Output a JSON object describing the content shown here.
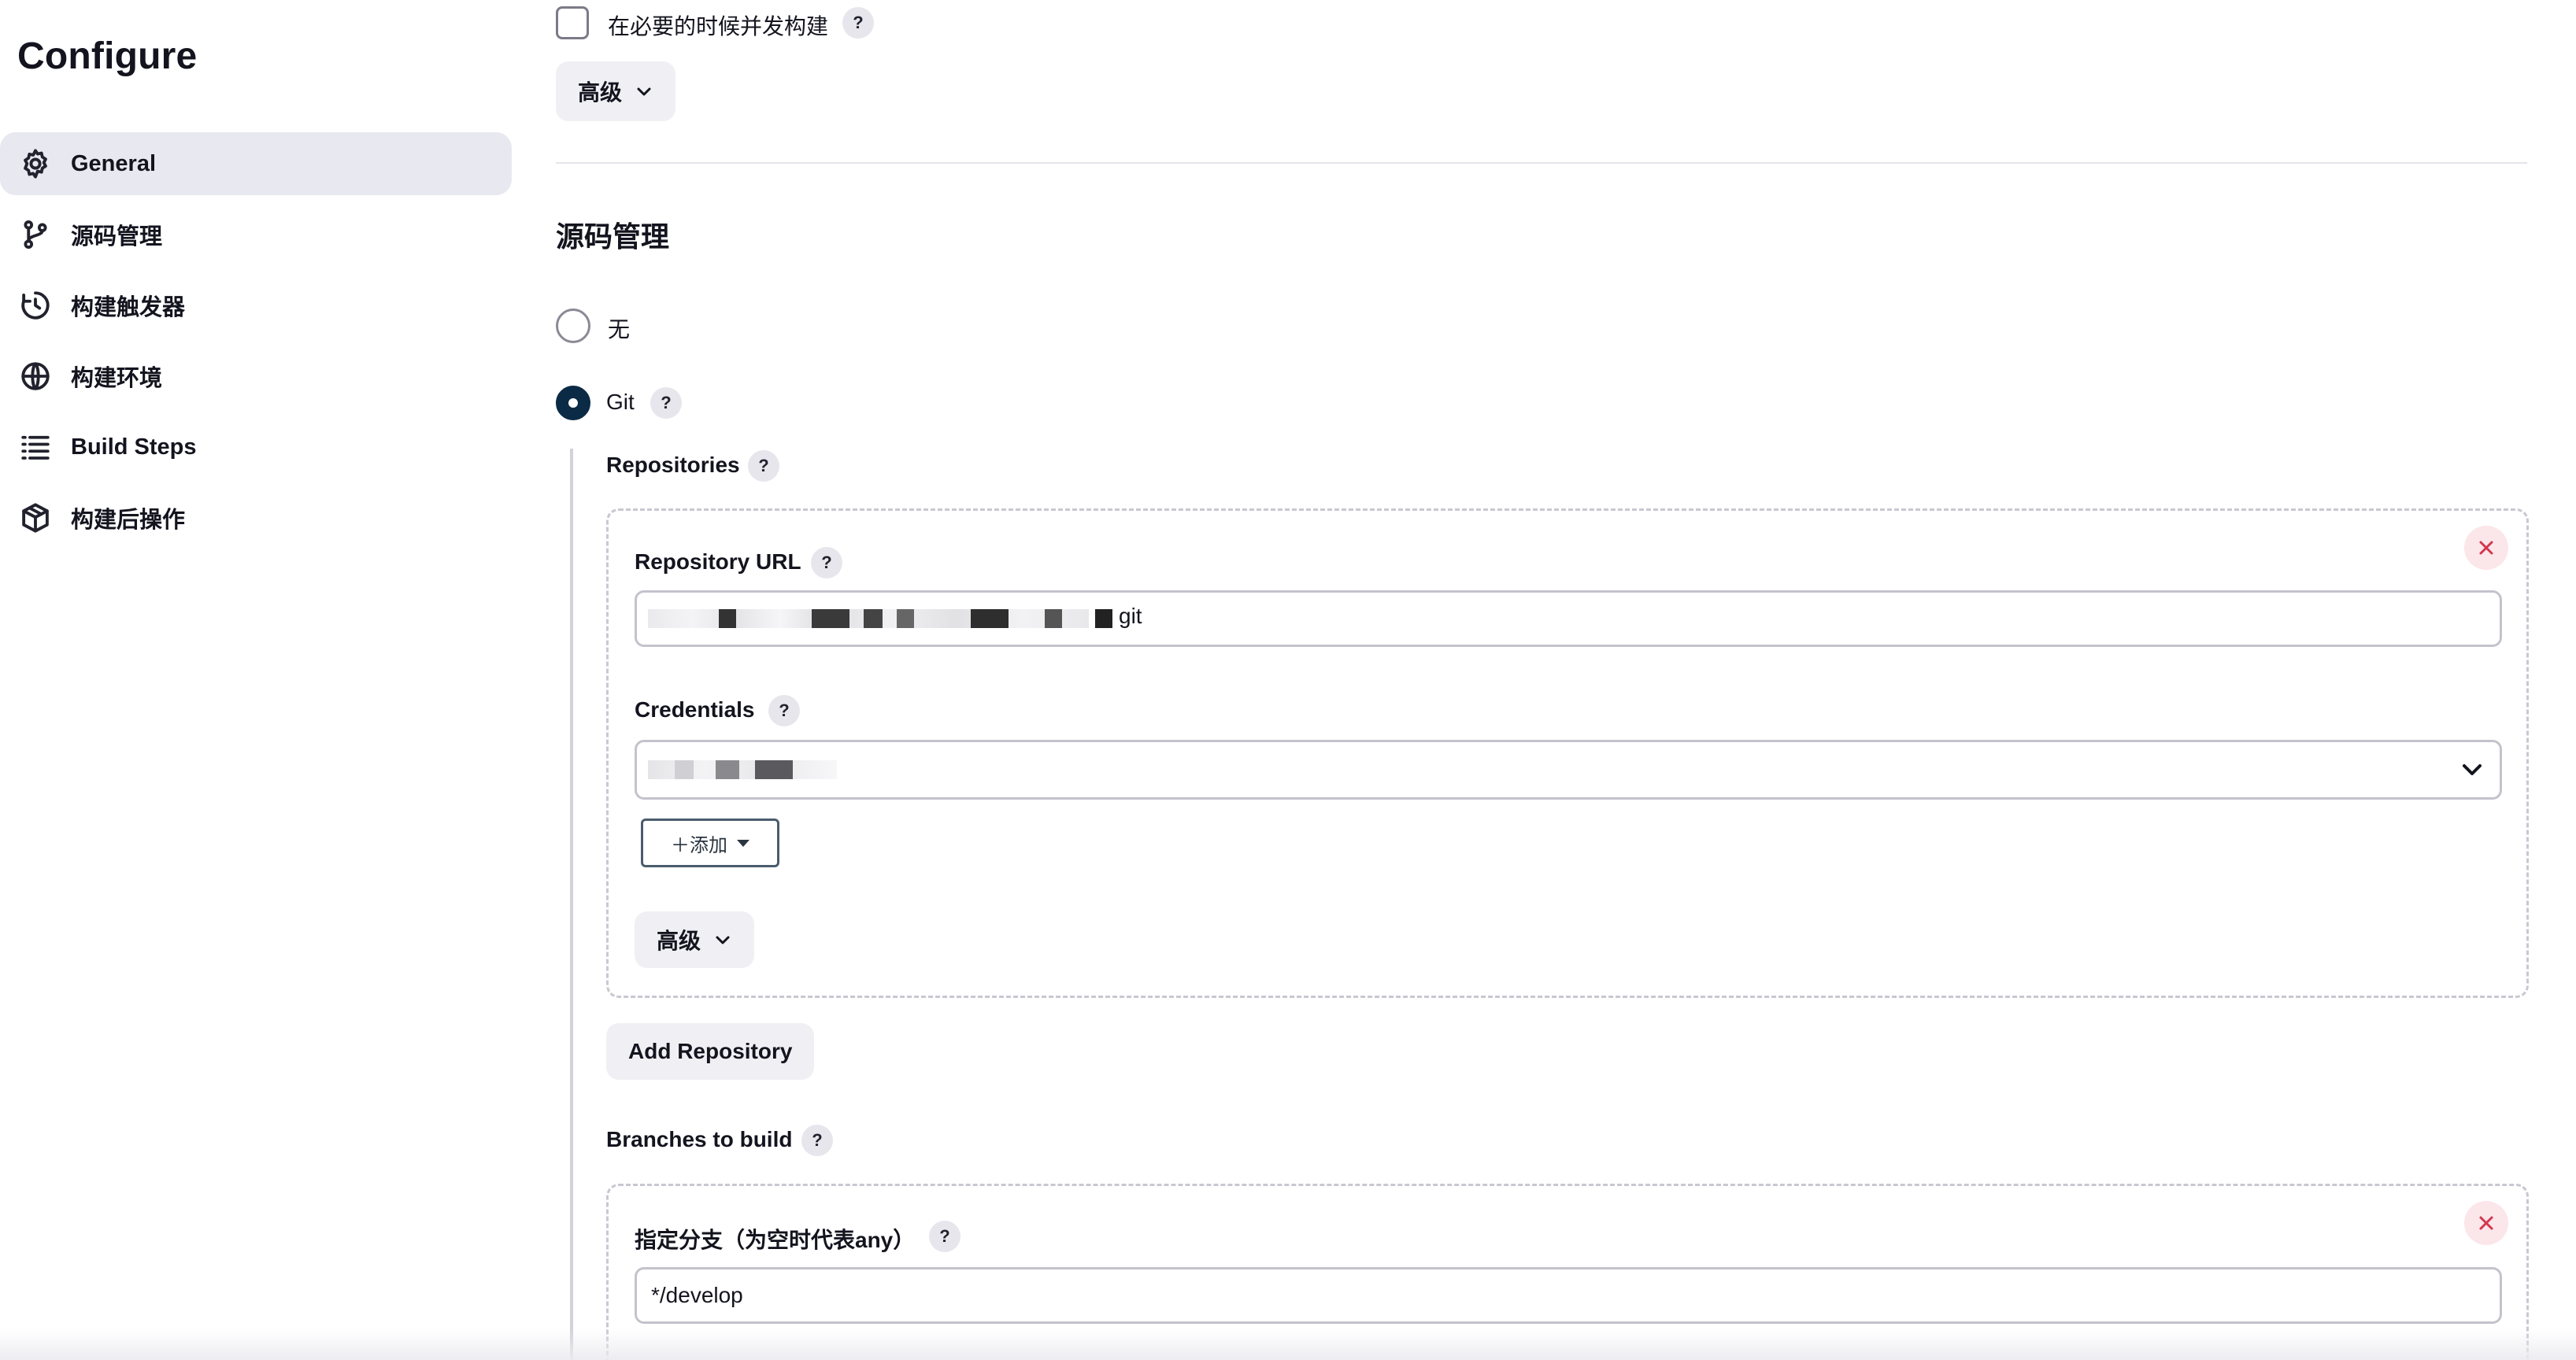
{
  "page": {
    "title": "Configure"
  },
  "sidebar": {
    "items": [
      {
        "label": "General",
        "icon": "gear-icon",
        "active": true
      },
      {
        "label": "源码管理",
        "icon": "branch-icon",
        "active": false
      },
      {
        "label": "构建触发器",
        "icon": "clock-icon",
        "active": false
      },
      {
        "label": "构建环境",
        "icon": "globe-icon",
        "active": false
      },
      {
        "label": "Build Steps",
        "icon": "list-icon",
        "active": false
      },
      {
        "label": "构建后操作",
        "icon": "package-icon",
        "active": false
      }
    ]
  },
  "general": {
    "concurrent_build_label": "在必要的时候并发构建",
    "concurrent_build_checked": false,
    "advanced_label": "高级"
  },
  "scm": {
    "section_title": "源码管理",
    "options": [
      {
        "label": "无",
        "checked": false
      },
      {
        "label": "Git",
        "checked": true
      }
    ],
    "repositories_label": "Repositories",
    "repository": {
      "url_label": "Repository URL",
      "url_value_suffix": "git",
      "credentials_label": "Credentials",
      "add_label": "＋添加",
      "advanced_label": "高级"
    },
    "add_repository_label": "Add Repository",
    "branches_label": "Branches to build",
    "branch": {
      "specifier_label": "指定分支（为空时代表any）",
      "specifier_value": "*/develop"
    }
  },
  "help_glyph": "?",
  "colors": {
    "radio_selected": "#0b2a45",
    "active_nav_bg": "#e8e8f0",
    "close_icon": "#d4364f"
  }
}
